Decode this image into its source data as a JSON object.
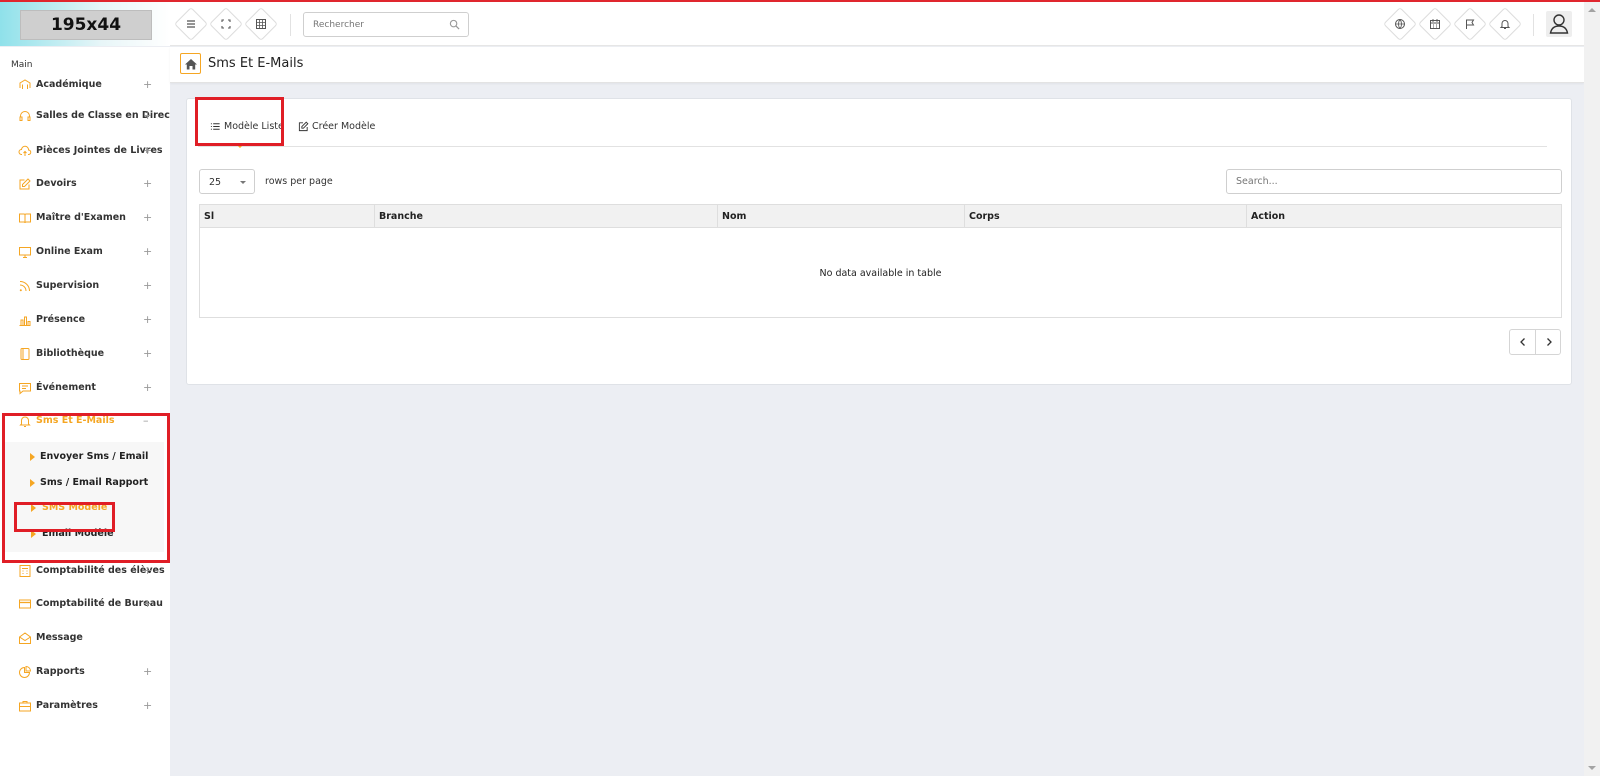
{
  "header": {
    "logo_text": "195x44",
    "search_placeholder": "Rechercher"
  },
  "sidebar": {
    "section_label": "Main",
    "items": [
      {
        "label": "Académique",
        "icon": "academic-icon",
        "expand": "+"
      },
      {
        "label": "Salles de Classe en Direct",
        "icon": "headset-icon",
        "expand": "+"
      },
      {
        "label": "Pièces Jointes de Livres",
        "icon": "cloud-upload-icon",
        "expand": "+"
      },
      {
        "label": "Devoirs",
        "icon": "edit-icon",
        "expand": "+"
      },
      {
        "label": "Maître d'Examen",
        "icon": "book-icon",
        "expand": "+"
      },
      {
        "label": "Online Exam",
        "icon": "monitor-icon",
        "expand": "+"
      },
      {
        "label": "Supervision",
        "icon": "rss-icon",
        "expand": "+"
      },
      {
        "label": "Présence",
        "icon": "bar-chart-icon",
        "expand": "+"
      },
      {
        "label": "Bibliothèque",
        "icon": "library-icon",
        "expand": "+"
      },
      {
        "label": "Événement",
        "icon": "message-icon",
        "expand": "+"
      },
      {
        "label": "Sms Et E-Mails",
        "icon": "bell-icon",
        "expand": "–"
      },
      {
        "label": "Comptabilité des élèves",
        "icon": "calculator-icon",
        "expand": "+"
      },
      {
        "label": "Comptabilité de Bureau",
        "icon": "credit-card-icon",
        "expand": "+"
      },
      {
        "label": "Message",
        "icon": "envelope-open-icon",
        "expand": ""
      },
      {
        "label": "Rapports",
        "icon": "pie-chart-icon",
        "expand": "+"
      },
      {
        "label": "Paramètres",
        "icon": "briefcase-icon",
        "expand": "+"
      }
    ],
    "sub_items": [
      {
        "label": "Envoyer Sms / Email"
      },
      {
        "label": "Sms / Email Rapport"
      },
      {
        "label": "SMS Modèle"
      },
      {
        "label": "Email Modèle"
      }
    ]
  },
  "page": {
    "title": "Sms Et E-Mails"
  },
  "tabs": {
    "list_label": "Modèle Liste",
    "create_label": "Créer Modèle"
  },
  "table": {
    "rows_per_page_value": "25",
    "rows_per_page_label": "rows per page",
    "search_placeholder": "Search...",
    "columns": [
      "Sl",
      "Branche",
      "Nom",
      "Corps",
      "Action"
    ],
    "empty_text": "No data available in table"
  },
  "colors": {
    "accent": "#f5a623",
    "highlight_box": "#e01e26",
    "top_line": "#e0262e"
  }
}
